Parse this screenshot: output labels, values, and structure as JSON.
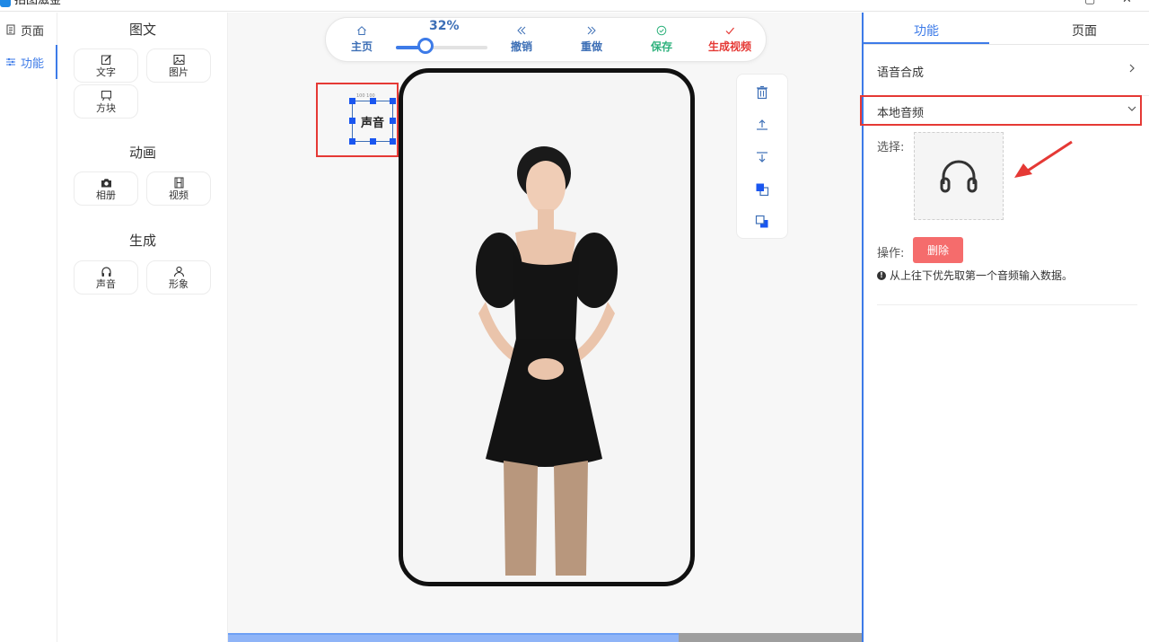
{
  "window": {
    "title": "拍图滋金"
  },
  "leftnav": {
    "items": [
      {
        "label": "页面",
        "icon": "page-icon"
      },
      {
        "label": "功能",
        "icon": "sliders-icon"
      }
    ]
  },
  "palette": {
    "sections": [
      {
        "title": "图文",
        "items": [
          {
            "label": "文字",
            "icon": "edit-icon"
          },
          {
            "label": "图片",
            "icon": "image-icon"
          },
          {
            "label": "方块",
            "icon": "board-icon"
          }
        ]
      },
      {
        "title": "动画",
        "items": [
          {
            "label": "相册",
            "icon": "camera-icon"
          },
          {
            "label": "视频",
            "icon": "film-icon"
          }
        ]
      },
      {
        "title": "生成",
        "items": [
          {
            "label": "声音",
            "icon": "headphones-icon"
          },
          {
            "label": "形象",
            "icon": "person-icon"
          }
        ]
      }
    ]
  },
  "toolbar": {
    "zoom": "32%",
    "zoom_fraction": 0.32,
    "home": "主页",
    "undo": "撤销",
    "redo": "重做",
    "save": "保存",
    "generate": "生成视频",
    "colors": {
      "primary": "#3d6fb6",
      "save": "#2fb27d",
      "generate": "#e53935"
    }
  },
  "canvas": {
    "element_label": "声音",
    "element_dims": "100 100"
  },
  "side_tools": [
    "trash-icon",
    "bring-up-icon",
    "send-down-icon",
    "bring-front-icon",
    "send-back-icon"
  ],
  "rightpanel": {
    "tabs": [
      "功能",
      "页面"
    ],
    "active_tab": "功能",
    "rows": {
      "tts": "语音合成",
      "local_audio": "本地音频"
    },
    "choose_label": "选择:",
    "operation_label": "操作:",
    "delete_label": "删除",
    "hint": "从上往下优先取第一个音频输入数据。"
  },
  "colors": {
    "accent": "#3d7be8",
    "highlight": "#e53935",
    "delete": "#f56c6c"
  }
}
